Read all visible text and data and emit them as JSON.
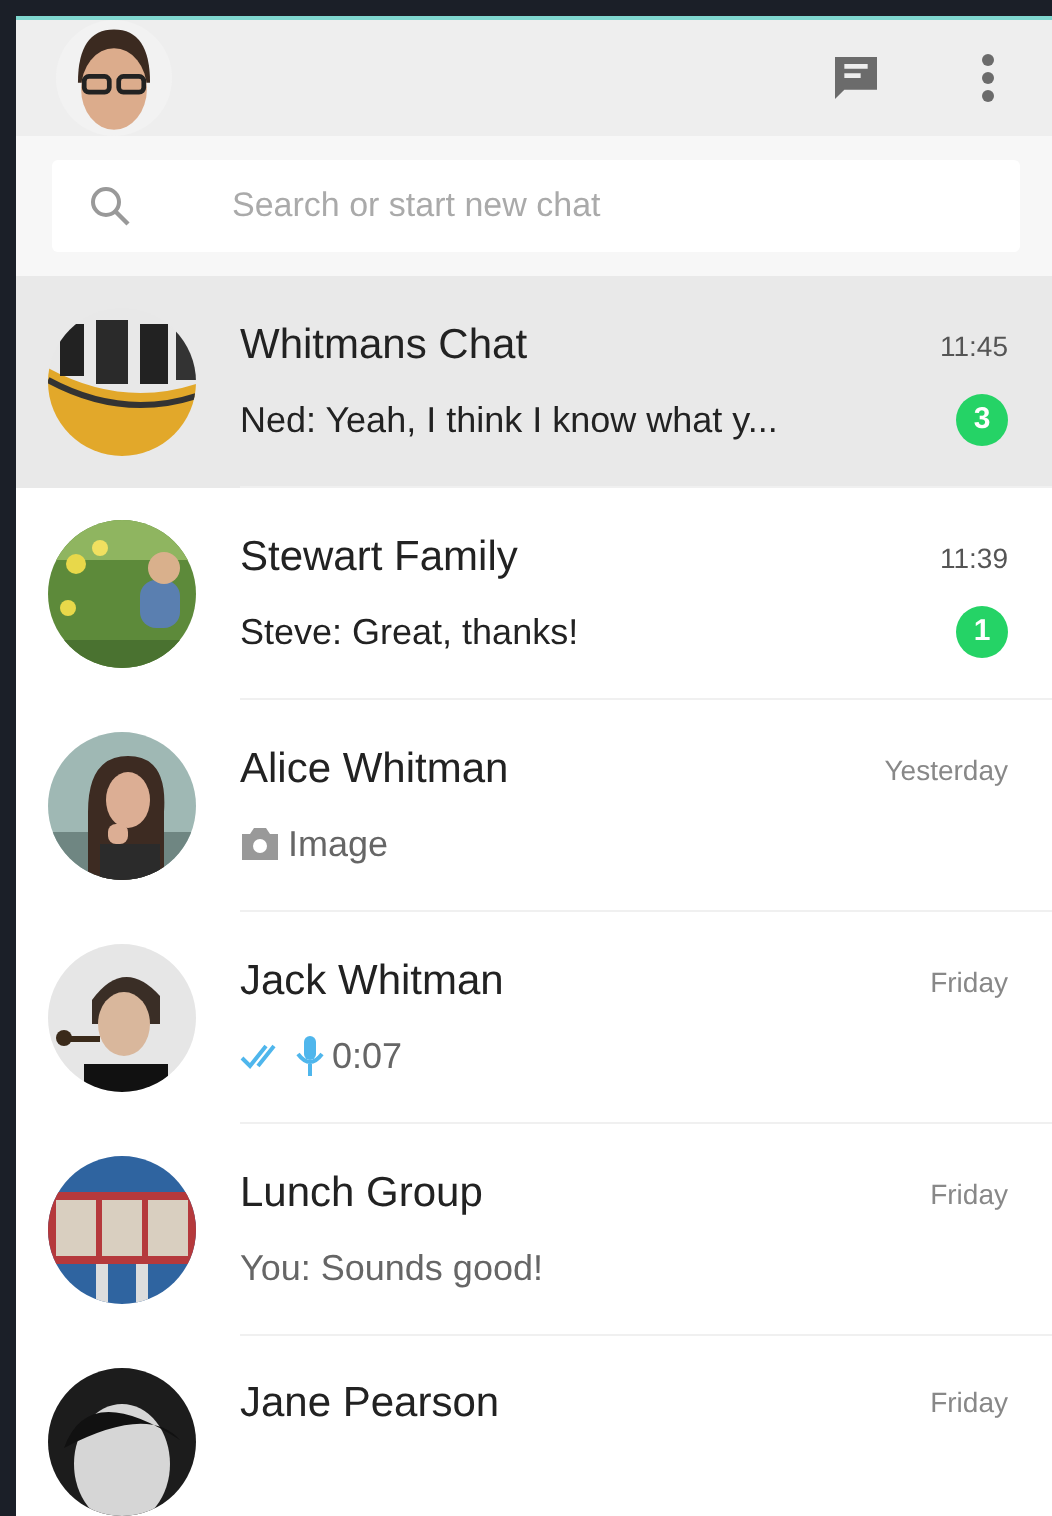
{
  "search": {
    "placeholder": "Search or start new chat"
  },
  "chats": [
    {
      "name": "Whitmans Chat",
      "time": "11:45",
      "selected": true,
      "preview": {
        "kind": "text",
        "text": "Ned: Yeah, I think I know what y..."
      },
      "unread": "3"
    },
    {
      "name": "Stewart Family",
      "time": "11:39",
      "selected": false,
      "preview": {
        "kind": "text",
        "text": "Steve: Great, thanks!"
      },
      "unread": "1"
    },
    {
      "name": "Alice Whitman",
      "time": "Yesterday",
      "selected": false,
      "preview": {
        "text": "Image"
      }
    },
    {
      "name": "Jack Whitman",
      "time": "Friday",
      "selected": false,
      "preview": {
        "kind": "voice",
        "text": "0:07",
        "read": true
      }
    },
    {
      "name": "Lunch Group",
      "time": "Friday",
      "selected": false,
      "preview": {
        "kind": "text",
        "text": "You: Sounds good!"
      }
    },
    {
      "name": "Jane Pearson",
      "time": "Friday",
      "selected": false
    }
  ]
}
